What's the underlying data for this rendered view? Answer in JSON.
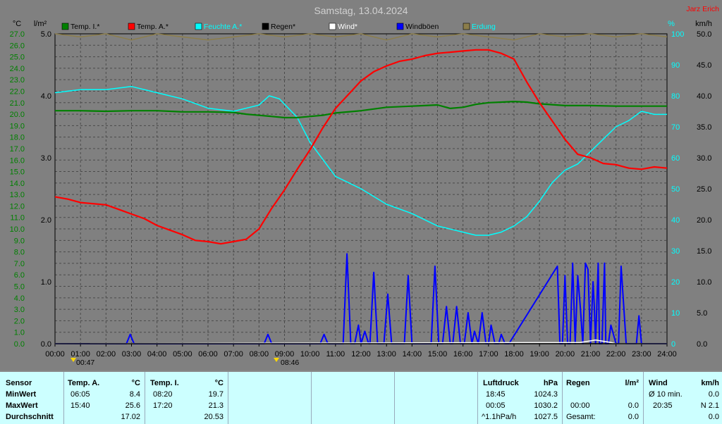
{
  "title": "Samstag, 13.04.2024",
  "author": "Jarz Erich",
  "axes": {
    "left_unit": "°C",
    "left2_unit": "l/m²",
    "right_unit": "%",
    "right2_unit": "km/h"
  },
  "legend": [
    {
      "label": "Temp. I.*",
      "color": "#008000",
      "text_color": "#000000"
    },
    {
      "label": "Temp. A.*",
      "color": "#ff0000",
      "text_color": "#000000"
    },
    {
      "label": "Feuchte A.*",
      "color": "#00ffff",
      "text_color": "#00ffff"
    },
    {
      "label": "Regen*",
      "color": "#000000",
      "text_color": "#000000"
    },
    {
      "label": "Wind*",
      "color": "#ffffff",
      "text_color": "#ffffff"
    },
    {
      "label": "Windböen",
      "color": "#0000ff",
      "text_color": "#000000"
    },
    {
      "label": "Erdung",
      "color": "#8b7d4b",
      "text_color": "#00ffff"
    }
  ],
  "sun_markers": {
    "sunrise": "00:47",
    "sunset": "08:46"
  },
  "chart_data": {
    "type": "line",
    "xlabel": "",
    "x_range_hours": [
      0,
      24
    ],
    "x_ticks": [
      "00:00",
      "01:00",
      "02:00",
      "03:00",
      "04:00",
      "05:00",
      "06:00",
      "07:00",
      "08:00",
      "09:00",
      "10:00",
      "11:00",
      "12:00",
      "13:00",
      "14:00",
      "15:00",
      "16:00",
      "17:00",
      "18:00",
      "19:00",
      "20:00",
      "21:00",
      "22:00",
      "23:00",
      "24:00"
    ],
    "left_axis": {
      "label": "°C",
      "range": [
        0.0,
        27.0
      ],
      "ticks": [
        "0.0",
        "1.0",
        "2.0",
        "3.0",
        "4.0",
        "5.0",
        "6.0",
        "7.0",
        "8.0",
        "9.0",
        "10.0",
        "11.0",
        "12.0",
        "13.0",
        "14.0",
        "15.0",
        "16.0",
        "17.0",
        "18.0",
        "19.0",
        "20.0",
        "21.0",
        "22.0",
        "23.0",
        "24.0",
        "25.0",
        "26.0",
        "27.0"
      ]
    },
    "rain_axis": {
      "label": "l/m²",
      "range": [
        0.0,
        5.0
      ],
      "ticks": [
        "0.0",
        "1.0",
        "2.0",
        "3.0",
        "4.0",
        "5.0"
      ]
    },
    "humidity_axis": {
      "label": "%",
      "range": [
        0,
        100
      ],
      "ticks": [
        "0",
        "10",
        "20",
        "30",
        "40",
        "50",
        "60",
        "70",
        "80",
        "90",
        "100"
      ]
    },
    "wind_axis": {
      "label": "km/h",
      "range": [
        0.0,
        50.0
      ],
      "ticks": [
        "0.0",
        "5.0",
        "10.0",
        "15.0",
        "20.0",
        "25.0",
        "30.0",
        "35.0",
        "40.0",
        "45.0",
        "50.0"
      ]
    },
    "series": [
      {
        "name": "Temp. I.*",
        "axis": "left",
        "color": "#008000",
        "x": [
          0,
          1,
          2,
          3,
          4,
          5,
          6,
          7,
          7.5,
          8,
          8.5,
          9,
          9.5,
          10,
          10.5,
          11,
          12,
          13,
          14,
          14.5,
          15,
          15.5,
          16,
          16.5,
          17,
          17.5,
          18,
          18.5,
          19,
          20,
          21,
          22,
          23,
          24
        ],
        "y": [
          20.3,
          20.3,
          20.25,
          20.3,
          20.3,
          20.2,
          20.2,
          20.15,
          20.0,
          19.9,
          19.8,
          19.7,
          19.7,
          19.8,
          19.9,
          20.1,
          20.3,
          20.6,
          20.7,
          20.75,
          20.8,
          20.5,
          20.6,
          20.85,
          21.0,
          21.05,
          21.1,
          21.05,
          20.9,
          20.75,
          20.75,
          20.7,
          20.7,
          20.7
        ]
      },
      {
        "name": "Temp. A.*",
        "axis": "left",
        "color": "#ff0000",
        "x": [
          0,
          0.5,
          1,
          2,
          2.5,
          3,
          3.5,
          4,
          4.5,
          5,
          5.5,
          6,
          6.5,
          7,
          7.5,
          8,
          8.5,
          9,
          9.5,
          10,
          10.5,
          11,
          11.5,
          12,
          12.5,
          13,
          13.5,
          14,
          14.5,
          15,
          15.5,
          16,
          16.5,
          17,
          17.5,
          18,
          18.5,
          19,
          19.5,
          20,
          20.5,
          21,
          21.5,
          22,
          22.5,
          23,
          23.5,
          24
        ],
        "y": [
          12.8,
          12.6,
          12.3,
          12.1,
          11.7,
          11.3,
          10.9,
          10.3,
          9.9,
          9.5,
          9.0,
          8.9,
          8.7,
          8.9,
          9.1,
          10.0,
          11.8,
          13.4,
          15.2,
          16.9,
          18.8,
          20.5,
          21.7,
          22.9,
          23.7,
          24.2,
          24.6,
          24.8,
          25.1,
          25.3,
          25.4,
          25.5,
          25.6,
          25.6,
          25.3,
          24.8,
          22.8,
          21.0,
          19.4,
          17.8,
          16.5,
          16.2,
          15.7,
          15.6,
          15.3,
          15.2,
          15.4,
          15.3
        ]
      },
      {
        "name": "Feuchte A.*",
        "axis": "humidity",
        "color": "#00ffff",
        "x": [
          0,
          1,
          2,
          3,
          4,
          5,
          6,
          7,
          8,
          8.4,
          8.8,
          9.5,
          10,
          11,
          12,
          13,
          14,
          15,
          15.5,
          16,
          16.5,
          17,
          17.5,
          18,
          18.5,
          19,
          19.5,
          20,
          20.5,
          21,
          21.5,
          22,
          22.5,
          23,
          23.5,
          24
        ],
        "y": [
          81,
          82,
          82,
          83,
          81,
          79,
          76,
          75,
          77,
          80,
          79,
          73,
          65,
          54,
          50,
          45,
          42,
          38,
          37,
          36,
          35,
          35,
          36,
          38,
          41,
          46,
          52,
          56,
          58,
          62,
          66,
          70,
          72,
          75,
          74,
          74
        ]
      },
      {
        "name": "Windböen",
        "axis": "wind",
        "color": "#0000ff",
        "x": [
          0,
          2.8,
          2.95,
          3.1,
          8.2,
          8.35,
          8.5,
          10.4,
          10.55,
          10.7,
          11.3,
          11.45,
          11.6,
          11.75,
          11.9,
          12.0,
          12.15,
          12.3,
          12.35,
          12.5,
          12.65,
          12.8,
          12.9,
          13.05,
          13.2,
          13.7,
          13.85,
          14.0,
          14.75,
          14.9,
          15.05,
          15.2,
          15.35,
          15.5,
          15.6,
          15.75,
          15.9,
          16.05,
          16.2,
          16.35,
          16.45,
          16.6,
          16.75,
          16.9,
          17.0,
          17.1,
          17.25,
          17.4,
          17.5,
          17.65,
          17.8,
          19.7,
          19.8,
          19.9,
          20.0,
          20.1,
          20.2,
          20.3,
          20.4,
          20.5,
          20.6,
          20.7,
          20.8,
          20.9,
          21.0,
          21.1,
          21.15,
          21.2,
          21.3,
          21.35,
          21.45,
          21.55,
          21.6,
          21.7,
          21.8,
          22.0,
          22.1,
          22.2,
          22.4,
          22.5,
          22.55,
          22.6,
          22.8,
          22.9,
          23.0,
          24
        ],
        "y": [
          0,
          0,
          1.5,
          0,
          0,
          1.5,
          0,
          0,
          1.5,
          0,
          0,
          14.5,
          0,
          0,
          3,
          0,
          2,
          0,
          0,
          11.5,
          0,
          0,
          0,
          8,
          0,
          0,
          11,
          0,
          0,
          12.5,
          0,
          0,
          6,
          0,
          0,
          6,
          0,
          0,
          5,
          0,
          2,
          0,
          5,
          0,
          0,
          3,
          0,
          0,
          1.5,
          0,
          0,
          12.5,
          0,
          0,
          11,
          0,
          0,
          13,
          0,
          11,
          6,
          0,
          13,
          12,
          0,
          10,
          6,
          0,
          13,
          0,
          0,
          13,
          0,
          0,
          3,
          0,
          0,
          12.5,
          0,
          0,
          0,
          0,
          0,
          4.5,
          0,
          0
        ]
      },
      {
        "name": "Wind*",
        "axis": "wind",
        "color": "#ffffff",
        "x": [
          0,
          20.6,
          20.9,
          21.2,
          21.5,
          21.8,
          22,
          24
        ],
        "y": [
          0,
          0.2,
          0.4,
          0.6,
          0.4,
          0.2,
          0,
          0
        ]
      },
      {
        "name": "Erdung",
        "axis": "humidity",
        "color": "#8b7d4b",
        "x": [
          0,
          1,
          2,
          3,
          4,
          5,
          6,
          7,
          8,
          9,
          10,
          11,
          12,
          13,
          14,
          15,
          16,
          17,
          18,
          19,
          20,
          21,
          22,
          23,
          24
        ],
        "y": [
          100,
          99,
          100,
          98,
          100,
          99,
          98,
          99,
          100,
          99,
          100,
          99,
          100,
          98,
          100,
          99,
          100,
          99,
          98,
          100,
          99,
          100,
          99,
          100,
          99
        ]
      },
      {
        "name": "Regen*",
        "axis": "rain",
        "color": "#000000",
        "x": [
          0,
          24
        ],
        "y": [
          0,
          0
        ]
      }
    ]
  },
  "table": {
    "sensor": {
      "header": "Sensor",
      "rows": [
        "MinWert",
        "MaxWert",
        "Durchschnitt"
      ]
    },
    "temp_a": {
      "header": "Temp. A.",
      "unit": "°C",
      "min_time": "06:05",
      "min_val": "8.4",
      "max_time": "15:40",
      "max_val": "25.6",
      "avg_val": "17.02"
    },
    "temp_i": {
      "header": "Temp. I.",
      "unit": "°C",
      "min_time": "08:20",
      "min_val": "19.7",
      "max_time": "17:20",
      "max_val": "21.3",
      "avg_val": "20.53"
    },
    "luftdruck": {
      "header": "Luftdruck",
      "unit": "hPa",
      "min_time": "18:45",
      "min_val": "1024.3",
      "max_time": "00:05",
      "max_val": "1030.2",
      "avg_label": "^1.1hPa/h",
      "avg_val": "1027.5"
    },
    "regen": {
      "header": "Regen",
      "unit": "l/m²",
      "max_time": "00:00",
      "max_val": "0.0",
      "avg_label": "Gesamt:",
      "avg_val": "0.0"
    },
    "wind": {
      "header": "Wind",
      "unit": "km/h",
      "min_label": "Ø 10 min.",
      "min_val": "0.0",
      "max_time": "20:35",
      "max_val": "N 2.1",
      "avg_val": "0.0"
    }
  }
}
